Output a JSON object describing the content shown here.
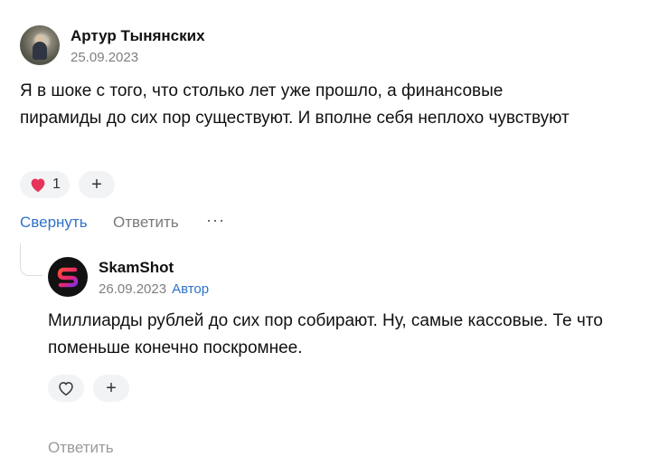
{
  "comment": {
    "author": "Артур Тынянских",
    "date": "25.09.2023",
    "text": "Я в шоке с того, что столько лет уже прошло, а финансовые пирамиды до сих пор существуют. И вполне себя неплохо чувствуют",
    "likes": "1",
    "add_reaction": "+",
    "actions": {
      "collapse": "Свернуть",
      "reply": "Ответить",
      "more": "···"
    }
  },
  "reply": {
    "author": "SkamShot",
    "date": "26.09.2023",
    "badge": "Автор",
    "text": "Миллиарды рублей до сих пор собирают. Ну, самые кассовые. Те что поменьше конечно поскромнее.",
    "add_reaction": "+",
    "reply_action": "Ответить"
  },
  "colors": {
    "accent": "#2f73c9",
    "heart": "#e6335a",
    "muted": "#7f7f7f",
    "pill_bg": "#f2f3f5"
  },
  "icons": {
    "liked": "heart-filled-icon",
    "like": "heart-outline-icon",
    "add": "plus-icon",
    "more": "more-dots-icon"
  }
}
